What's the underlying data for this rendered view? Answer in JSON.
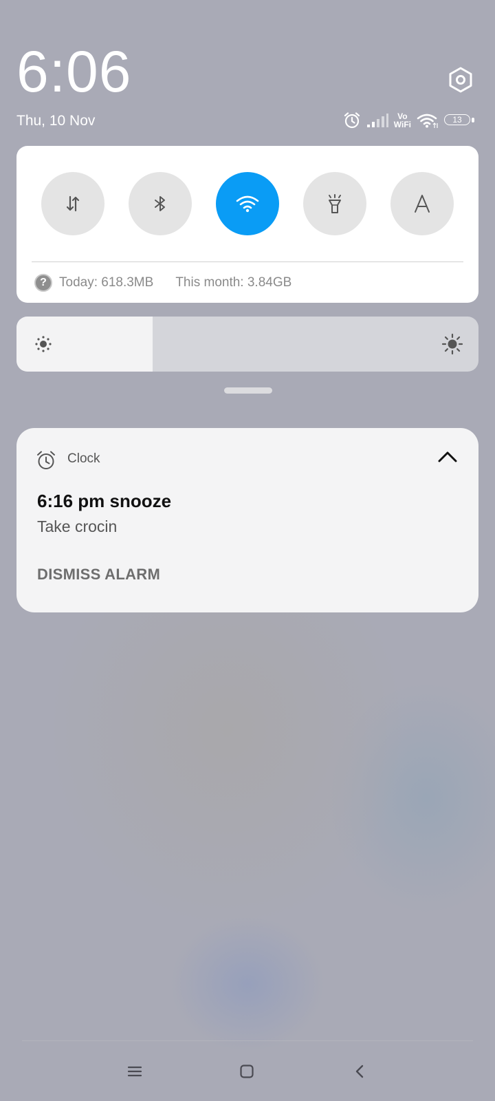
{
  "status": {
    "time": "6:06",
    "date": "Thu, 10 Nov",
    "volte_top": "Vo",
    "volte_bottom": "WiFi",
    "battery": "13"
  },
  "quick_settings": {
    "tiles": [
      {
        "name": "mobile-data",
        "icon": "mobile-data-icon",
        "active": false
      },
      {
        "name": "bluetooth",
        "icon": "bluetooth-icon",
        "active": false
      },
      {
        "name": "wifi",
        "icon": "wifi-icon",
        "active": true
      },
      {
        "name": "flashlight",
        "icon": "flashlight-icon",
        "active": false
      },
      {
        "name": "auto-brightness",
        "icon": "A",
        "active": false
      }
    ],
    "usage_today": "Today: 618.3MB",
    "usage_month": "This month: 3.84GB",
    "help_glyph": "?"
  },
  "brightness": {
    "level": 0.295
  },
  "notification": {
    "app_name": "Clock",
    "title": "6:16 pm snooze",
    "body": "Take crocin",
    "action": "DISMISS ALARM"
  },
  "colors": {
    "accent": "#0a9cf5"
  }
}
